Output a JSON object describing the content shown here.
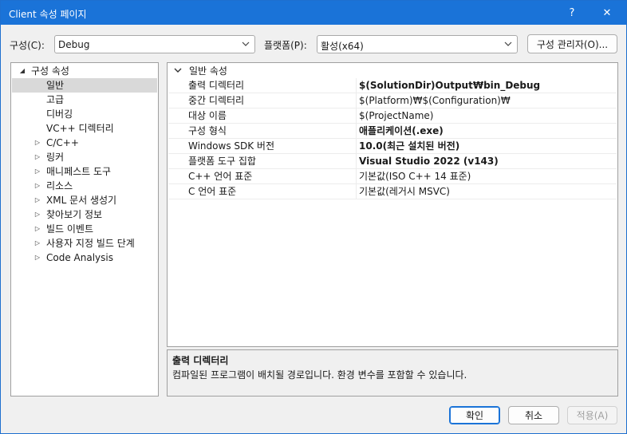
{
  "window": {
    "title": "Client 속성 페이지",
    "help_glyph": "?",
    "close_glyph": "✕"
  },
  "toolbar": {
    "config_label": "구성(C):",
    "config_value": "Debug",
    "platform_label": "플랫폼(P):",
    "platform_value": "활성(x64)",
    "config_manager_label": "구성 관리자(O)..."
  },
  "tree": {
    "root": "구성 속성",
    "items": [
      {
        "label": "일반",
        "expandable": false,
        "selected": true
      },
      {
        "label": "고급",
        "expandable": false,
        "selected": false
      },
      {
        "label": "디버깅",
        "expandable": false,
        "selected": false
      },
      {
        "label": "VC++ 디렉터리",
        "expandable": false,
        "selected": false
      },
      {
        "label": "C/C++",
        "expandable": true,
        "selected": false
      },
      {
        "label": "링커",
        "expandable": true,
        "selected": false
      },
      {
        "label": "매니페스트 도구",
        "expandable": true,
        "selected": false
      },
      {
        "label": "리소스",
        "expandable": true,
        "selected": false
      },
      {
        "label": "XML 문서 생성기",
        "expandable": true,
        "selected": false
      },
      {
        "label": "찾아보기 정보",
        "expandable": true,
        "selected": false
      },
      {
        "label": "빌드 이벤트",
        "expandable": true,
        "selected": false
      },
      {
        "label": "사용자 지정 빌드 단계",
        "expandable": true,
        "selected": false
      },
      {
        "label": "Code Analysis",
        "expandable": true,
        "selected": false
      }
    ]
  },
  "grid": {
    "category": "일반 속성",
    "rows": [
      {
        "name": "출력 디렉터리",
        "value": "$(SolutionDir)Output₩bin_Debug",
        "bold": true
      },
      {
        "name": "중간 디렉터리",
        "value": "$(Platform)₩$(Configuration)₩",
        "bold": false
      },
      {
        "name": "대상 이름",
        "value": "$(ProjectName)",
        "bold": false
      },
      {
        "name": "구성 형식",
        "value": "애플리케이션(.exe)",
        "bold": true
      },
      {
        "name": "Windows SDK 버전",
        "value": "10.0(최근 설치된 버전)",
        "bold": true
      },
      {
        "name": "플랫폼 도구 집합",
        "value": "Visual Studio 2022 (v143)",
        "bold": true
      },
      {
        "name": "C++ 언어 표준",
        "value": "기본값(ISO C++ 14 표준)",
        "bold": false
      },
      {
        "name": "C 언어 표준",
        "value": "기본값(레거시 MSVC)",
        "bold": false
      }
    ]
  },
  "description": {
    "title": "출력 디렉터리",
    "text": "컴파일된 프로그램이 배치될 경로입니다. 환경 변수를 포함할 수 있습니다."
  },
  "buttons": {
    "ok": "확인",
    "cancel": "취소",
    "apply": "적용(A)"
  },
  "colors": {
    "accent": "#1a73d8",
    "selection": "#d9d9d9"
  }
}
